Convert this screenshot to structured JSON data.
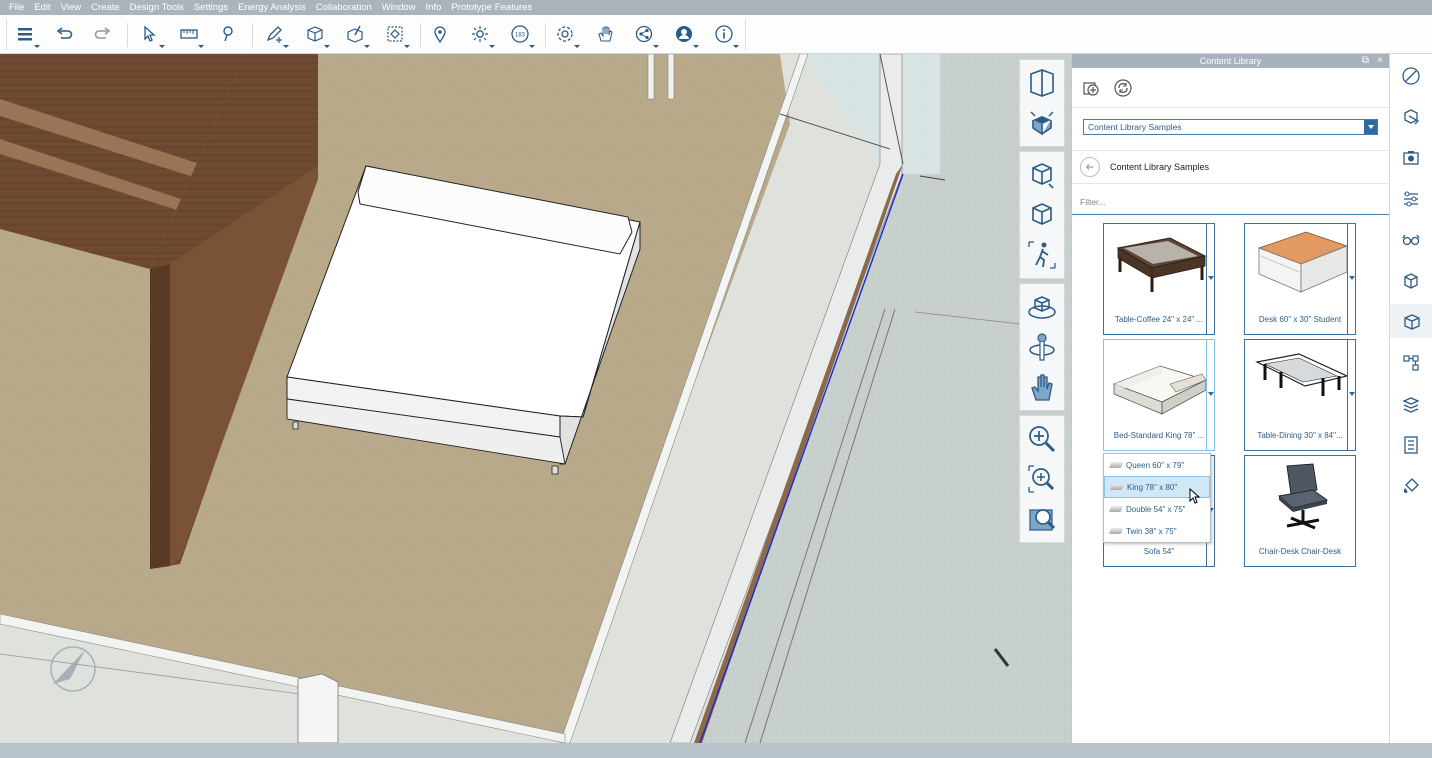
{
  "menu": [
    "File",
    "Edit",
    "View",
    "Create",
    "Design Tools",
    "Settings",
    "Energy Analysis",
    "Collaboration",
    "Window",
    "Info",
    "Prototype Features"
  ],
  "toolbar": {
    "icons": [
      "menu-list-icon",
      "undo-icon",
      "redo-icon",
      "select-icon",
      "measure-icon",
      "pin-icon",
      "pencil-sketch-icon",
      "box-create-icon",
      "box-modify-icon",
      "frame-icon",
      "location-pin-icon",
      "sun-icon",
      "date-icon",
      "settings-gear-icon",
      "hand-pan-icon",
      "share-icon",
      "account-icon",
      "info-icon"
    ],
    "date_text": "183"
  },
  "viewcube": {
    "icons": [
      "perspective-icon",
      "home-view-icon",
      "view-cube-icon",
      "orthographic-icon",
      "walk-icon",
      "orbit-icon",
      "look-around-icon",
      "pan-hand-icon",
      "zoom-in-icon",
      "zoom-window-icon",
      "zoom-extents-icon"
    ]
  },
  "panel": {
    "title": "Content Library",
    "dock_glyph": "⧉",
    "close_glyph": "×",
    "tools": [
      "add-library-icon",
      "refresh-icon"
    ],
    "library_select": "Content Library Samples",
    "breadcrumb": "Content Library Samples",
    "filter_placeholder": "Filter...",
    "items": [
      {
        "name": "Table-Coffee 24\" x 24\" ..."
      },
      {
        "name": "Desk 60\" x 30\" Student"
      },
      {
        "name": "Bed-Standard King 78\" ..."
      },
      {
        "name": "Table-Dining 30\" x 84\"..."
      },
      {
        "name": "Sofa 54\""
      },
      {
        "name": "Chair-Desk Chair-Desk"
      }
    ],
    "size_options": [
      "Queen 60\" x 79\"",
      "King 78\" x 80\"",
      "Double 54\" x 75\"",
      "Twin 38\" x 75\""
    ],
    "selected_option": "King 78\" x 80\""
  },
  "right_strip": {
    "icons": [
      "materials-icon",
      "styles-icon",
      "scenes-icon",
      "layers-icon",
      "view-glasses-icon",
      "model-browser-icon",
      "content-library-icon",
      "components-icon",
      "levels-icon",
      "properties-icon",
      "paint-icon"
    ],
    "active": "content-library-icon"
  },
  "colors": {
    "accent": "#2f6aa1",
    "menubar": "#a9b4bd",
    "floor": "#b8a98a",
    "wall_wood": "#6f4a30"
  }
}
